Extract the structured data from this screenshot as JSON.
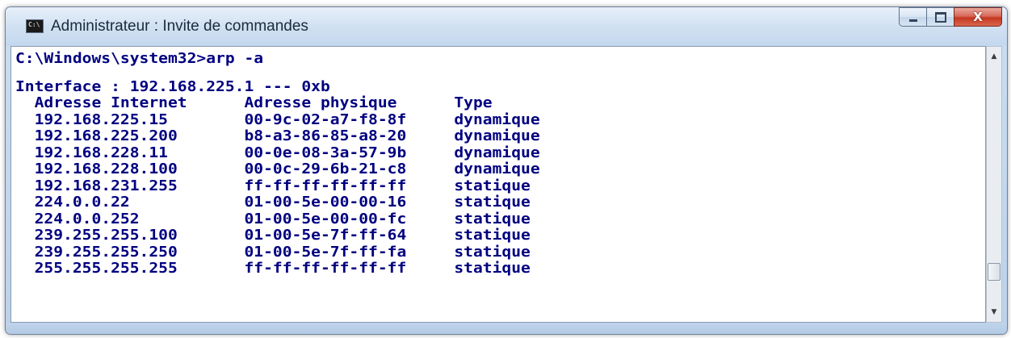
{
  "window": {
    "title": "Administrateur : Invite de commandes",
    "icon": "cmd-icon",
    "icon_text": "C:\\"
  },
  "caption_buttons": {
    "minimize": "minimize-icon",
    "maximize": "maximize-icon",
    "close": "close-icon",
    "close_glyph": "X"
  },
  "console": {
    "lines": [
      "C:\\Windows\\system32>arp -a",
      "",
      "Interface : 192.168.225.1 --- 0xb",
      "  Adresse Internet      Adresse physique      Type",
      "  192.168.225.15        00-9c-02-a7-f8-8f     dynamique",
      "  192.168.225.200       b8-a3-86-85-a8-20     dynamique",
      "  192.168.228.11        00-0e-08-3a-57-9b     dynamique",
      "  192.168.228.100       00-0c-29-6b-21-c8     dynamique",
      "  192.168.231.255       ff-ff-ff-ff-ff-ff     statique",
      "  224.0.0.22            01-00-5e-00-00-16     statique",
      "  224.0.0.252           01-00-5e-00-00-fc     statique",
      "  239.255.255.100       01-00-5e-7f-ff-64     statique",
      "  239.255.255.250       01-00-5e-7f-ff-fa     statique",
      "  255.255.255.255       ff-ff-ff-ff-ff-ff     statique"
    ],
    "text_color": "#000080",
    "background": "#ffffff"
  },
  "scrollbar": {
    "up_icon": "scroll-up-arrow-icon",
    "down_icon": "scroll-down-arrow-icon"
  }
}
